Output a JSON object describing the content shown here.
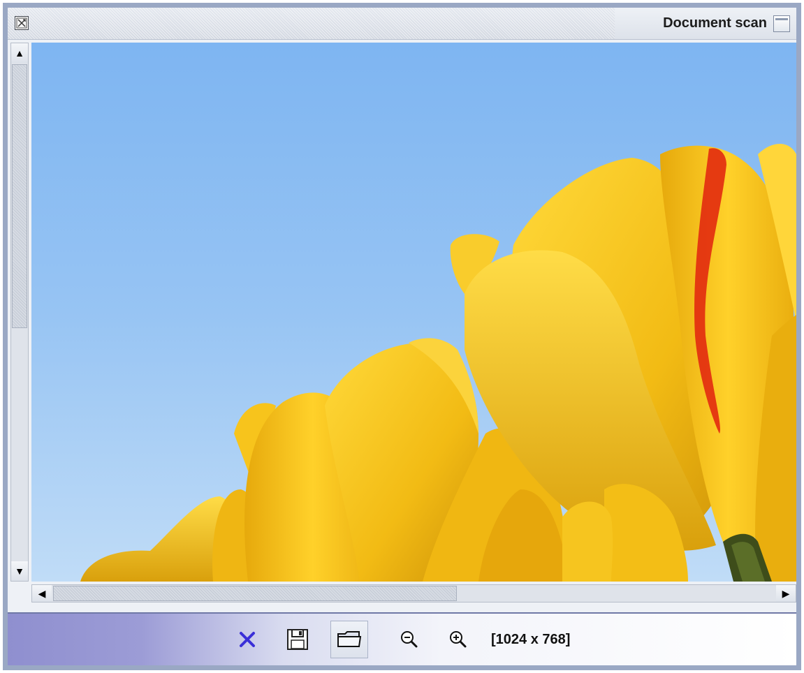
{
  "window": {
    "title": "Document scan",
    "icons": {
      "system": "close-box-icon",
      "maximize": "maximize-window-icon"
    }
  },
  "viewer": {
    "image_description_icon": "tulips-photo",
    "scroll": {
      "vertical_position": 0.0,
      "horizontal_position": 0.0
    }
  },
  "toolbar": {
    "buttons": [
      {
        "id": "close",
        "icon": "x-icon"
      },
      {
        "id": "save",
        "icon": "floppy-disk-icon"
      },
      {
        "id": "open",
        "icon": "folder-icon",
        "active": true
      },
      {
        "id": "zoom_out",
        "icon": "zoom-out-icon"
      },
      {
        "id": "zoom_in",
        "icon": "zoom-in-icon"
      }
    ],
    "image_size": "[1024 x 768]"
  },
  "colors": {
    "frame": "#9aa8c4",
    "sky_top": "#7eb5f2",
    "sky_bottom": "#c0dcf7",
    "tulip": "#f2c21b",
    "tulip_shadow": "#d39d0a",
    "stripe": "#e22a10",
    "close_x": "#3a2fd8"
  }
}
